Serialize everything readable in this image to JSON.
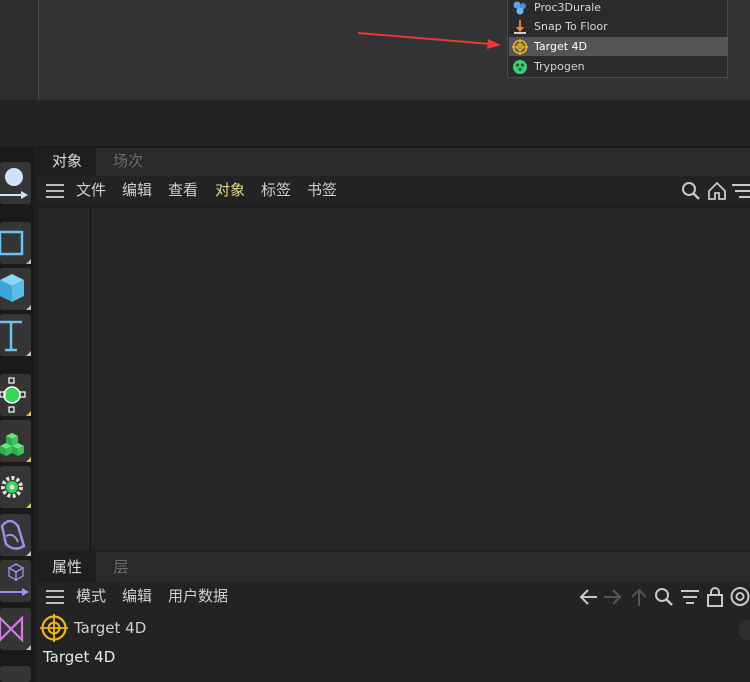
{
  "popup_menu": {
    "items": [
      {
        "label": "Proc3Durale",
        "icon": "proc3durale-icon",
        "selected": false
      },
      {
        "label": "Snap To Floor",
        "icon": "snap-to-floor-icon",
        "selected": false
      },
      {
        "label": "Target 4D",
        "icon": "target-4d-icon",
        "selected": true
      },
      {
        "label": "Trypogen",
        "icon": "trypogen-icon",
        "selected": false
      }
    ]
  },
  "object_panel": {
    "tabs": [
      {
        "label": "对象",
        "active": true
      },
      {
        "label": "场次",
        "active": false
      }
    ],
    "menu": [
      "文件",
      "编辑",
      "查看",
      "对象",
      "标签",
      "书签"
    ],
    "highlighted_menu": "对象",
    "right_icons": [
      "search-icon",
      "home-icon",
      "filter-icon"
    ]
  },
  "attributes_panel": {
    "tabs": [
      {
        "label": "属性",
        "active": true
      },
      {
        "label": "层",
        "active": false
      }
    ],
    "menu": [
      "模式",
      "编辑",
      "用户数据"
    ],
    "right_icons": [
      "back-arrow-icon",
      "forward-arrow-icon",
      "up-arrow-icon",
      "search-icon",
      "filter-icon",
      "lock-icon",
      "target-icon"
    ],
    "object_name": "Target 4D",
    "object_title": "Target 4D"
  },
  "toolbar_icons": [
    "sphere-arrow-icon",
    "rectangle-icon",
    "cube-icon",
    "text-icon",
    "spline-point-icon",
    "voxel-icon",
    "gear-icon",
    "deformer-icon",
    "small-cube-arrow-icon",
    "bowtie-icon"
  ],
  "colors": {
    "accent_yellow": "#e6d68a",
    "target_icon": "#f0b41e",
    "arrow_red": "#e53935",
    "tool_blue": "#6bc4f0",
    "tool_green": "#39d45a",
    "tool_purple": "#a08be8"
  }
}
